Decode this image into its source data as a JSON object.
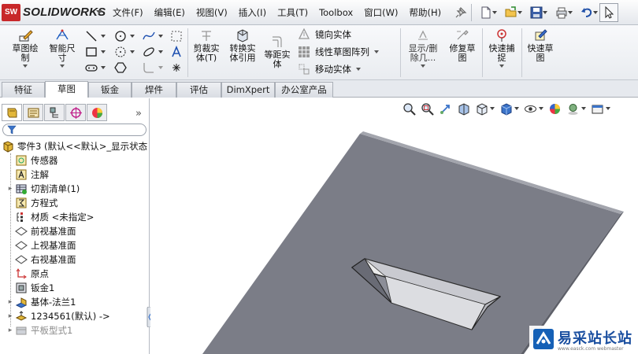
{
  "app": {
    "logo_badge": "SW",
    "name": "SOLIDWORKS"
  },
  "menubar": {
    "items": [
      "文件(F)",
      "编辑(E)",
      "视图(V)",
      "插入(I)",
      "工具(T)",
      "Toolbox",
      "窗口(W)",
      "帮助(H)"
    ]
  },
  "quick_access": {
    "icons": [
      "pin-icon",
      "new-document-icon",
      "open-folder-icon",
      "save-icon",
      "print-icon",
      "undo-icon",
      "select-pointer-icon"
    ]
  },
  "ribbon": {
    "sketch": "草图绘\n制",
    "smart_dim": "智能尺\n寸",
    "trim": "剪裁实\n体(T)",
    "convert": "转换实\n体引用",
    "offset": "等距实\n体",
    "mirror": "镜向实体",
    "linear_pattern": "线性草图阵列",
    "move": "移动实体",
    "show_hide": "显示/删\n除几...",
    "repair": "修复草\n图",
    "quick_snap": "快速捕\n捉",
    "rapid_sketch": "快速草\n图",
    "small_tools": [
      "line-icon",
      "circle-icon",
      "spline-icon",
      "rectangle-icon",
      "polygon-icon",
      "ellipse-icon",
      "slot-icon",
      "arc-icon",
      "point-icon",
      "text-icon",
      "fillet-icon",
      "plane-icon"
    ]
  },
  "tabs": [
    "特征",
    "草图",
    "钣金",
    "焊件",
    "评估",
    "DimXpert",
    "办公室产品"
  ],
  "active_tab": "草图",
  "feature_manager": {
    "tabs": [
      "feature-manager-tab",
      "property-manager-tab",
      "configuration-manager-tab",
      "dimxpert-manager-tab",
      "display-manager-tab"
    ],
    "more": "»",
    "filter_placeholder": "",
    "root": "零件3 (默认<<默认>_显示状态",
    "items": [
      {
        "label": "传感器",
        "icon": "sensor-icon"
      },
      {
        "label": "注解",
        "icon": "annotation-icon"
      },
      {
        "label": "切割清单(1)",
        "icon": "cut-list-icon"
      },
      {
        "label": "方程式",
        "icon": "equation-icon"
      },
      {
        "label": "材质 <未指定>",
        "icon": "material-icon"
      },
      {
        "label": "前视基准面",
        "icon": "plane-icon"
      },
      {
        "label": "上视基准面",
        "icon": "plane-icon"
      },
      {
        "label": "右视基准面",
        "icon": "plane-icon"
      },
      {
        "label": "原点",
        "icon": "origin-icon"
      },
      {
        "label": "钣金1",
        "icon": "sheet-metal-icon"
      },
      {
        "label": "基体-法兰1",
        "icon": "base-flange-icon"
      },
      {
        "label": "1234561(默认) ->",
        "icon": "library-feature-icon"
      },
      {
        "label": "平板型式1",
        "icon": "flat-pattern-icon"
      }
    ]
  },
  "view_toolbar": {
    "icons": [
      "zoom-to-fit-icon",
      "zoom-to-area-icon",
      "previous-view-icon",
      "section-view-icon",
      "view-orientation-icon",
      "display-style-icon",
      "hide-show-items-icon",
      "edit-appearance-icon",
      "apply-scene-icon",
      "view-settings-icon"
    ]
  },
  "watermark": {
    "text": "易采站长站",
    "url": "www.easck.com  webmaster"
  },
  "colors": {
    "part_gray": "#7b7d87",
    "brand_red": "#c8282a",
    "watermark_blue": "#1560b6"
  }
}
